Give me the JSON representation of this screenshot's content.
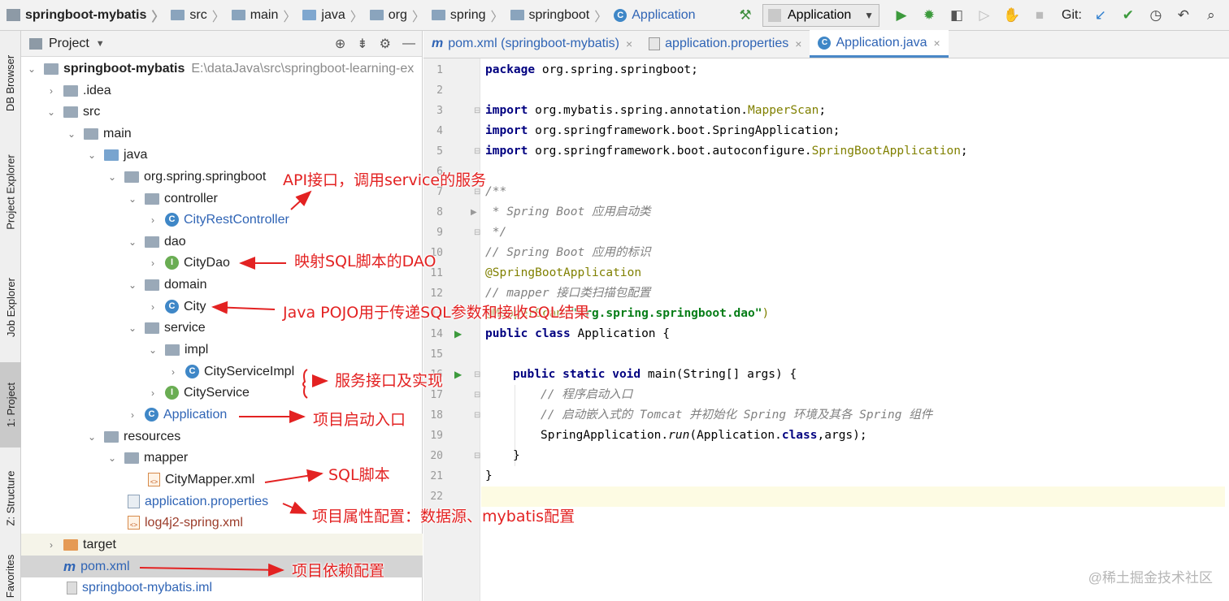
{
  "breadcrumb": [
    "springboot-mybatis",
    "src",
    "main",
    "java",
    "org",
    "spring",
    "springboot",
    "Application"
  ],
  "toolbar": {
    "run_config": "Application",
    "git_label": "Git:"
  },
  "left_strip": [
    "DB Browser",
    "Project Explorer",
    "Job Explorer",
    "1: Project",
    "Z: Structure",
    "Favorites"
  ],
  "project_panel": {
    "title": "Project",
    "root_name": "springboot-mybatis",
    "root_path": "E:\\dataJava\\src\\springboot-learning-ex",
    "tree": [
      {
        "label": ".idea"
      },
      {
        "label": "src"
      },
      {
        "label": "main"
      },
      {
        "label": "java"
      },
      {
        "label": "org.spring.springboot"
      },
      {
        "label": "controller"
      },
      {
        "label": "CityRestController"
      },
      {
        "label": "dao"
      },
      {
        "label": "CityDao"
      },
      {
        "label": "domain"
      },
      {
        "label": "City"
      },
      {
        "label": "service"
      },
      {
        "label": "impl"
      },
      {
        "label": "CityServiceImpl"
      },
      {
        "label": "CityService"
      },
      {
        "label": "Application"
      },
      {
        "label": "resources"
      },
      {
        "label": "mapper"
      },
      {
        "label": "CityMapper.xml"
      },
      {
        "label": "application.properties"
      },
      {
        "label": "log4j2-spring.xml"
      },
      {
        "label": "target"
      },
      {
        "label": "pom.xml"
      },
      {
        "label": "springboot-mybatis.iml"
      }
    ]
  },
  "editor": {
    "tabs": [
      "pom.xml (springboot-mybatis)",
      "application.properties",
      "Application.java"
    ],
    "line_numbers": [
      "1",
      "2",
      "3",
      "4",
      "5",
      "6",
      "7",
      "8",
      "9",
      "10",
      "11",
      "12",
      "13",
      "14",
      "15",
      "16",
      "17",
      "18",
      "19",
      "20",
      "21",
      "22"
    ],
    "code": {
      "l1_kw": "package",
      "l1_rest": " org.spring.springboot;",
      "l3_kw": "import",
      "l3_a": " org.mybatis.spring.annotation.",
      "l3_b": "MapperScan",
      "l3_c": ";",
      "l4_kw": "import",
      "l4_rest": " org.springframework.boot.SpringApplication;",
      "l5_kw": "import",
      "l5_a": " org.springframework.boot.autoconfigure.",
      "l5_b": "SpringBootApplication",
      "l5_c": ";",
      "l7": "/**",
      "l8": " * Spring Boot 应用启动类",
      "l9": " */",
      "l10": "// Spring Boot 应用的标识",
      "l11": "@SpringBootApplication",
      "l12": "// mapper 接口类扫描包配置",
      "l13_a": "@MapperScan(",
      "l13_b": "\"org.spring.springboot.dao\"",
      "l13_c": ")",
      "l14_kw": "public class",
      "l14_rest": " Application {",
      "l16_kw": "public static void",
      "l16_rest": " main(String[] args) {",
      "l17": "// 程序启动入口",
      "l18": "// 启动嵌入式的 Tomcat 并初始化 Spring 环境及其各 Spring 组件",
      "l19_a": "SpringApplication.",
      "l19_b": "run",
      "l19_c": "(Application.",
      "l19_d": "class",
      "l19_e": ",args);",
      "l20": "}",
      "l21": "}"
    }
  },
  "annotations": [
    "API接口，调用service的服务",
    "映射SQL脚本的DAO",
    "Java POJO用于传递SQL参数和接收SQL结果",
    "服务接口及实现",
    "项目启动入口",
    "SQL脚本",
    "项目属性配置：数据源、mybatis配置",
    "项目依赖配置"
  ],
  "watermark": "@稀土掘金技术社区",
  "colors": {
    "annotation_red": "#e32222",
    "link_blue": "#2f64b5",
    "keyword_navy": "#000080"
  }
}
